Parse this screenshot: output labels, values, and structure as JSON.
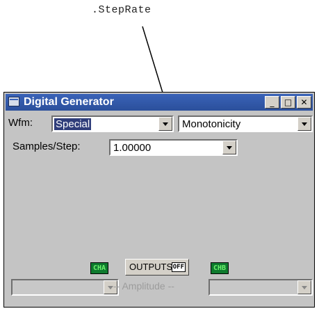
{
  "callout": {
    "text": ".StepRate"
  },
  "window": {
    "title": "Digital Generator",
    "controls": {
      "minimize": "_",
      "maximize": "□",
      "close": "✕"
    }
  },
  "waveform": {
    "label": "Wfm:",
    "value": "Special",
    "mode_value": "Monotonicity"
  },
  "samples_step": {
    "label": "Samples/Step:",
    "value": "1.00000"
  },
  "channels": {
    "cha": "CHA",
    "chb": "CHB"
  },
  "outputs": {
    "label": "OUTPUTS",
    "state": "OFF"
  },
  "amplitude": {
    "label": "-- Amplitude --",
    "left_value": "",
    "right_value": ""
  },
  "colors": {
    "titlebar": "#2b4f9b",
    "window_bg": "#c4c4c4",
    "badge_bg": "#0e7a2e",
    "badge_text": "#6df26d"
  }
}
